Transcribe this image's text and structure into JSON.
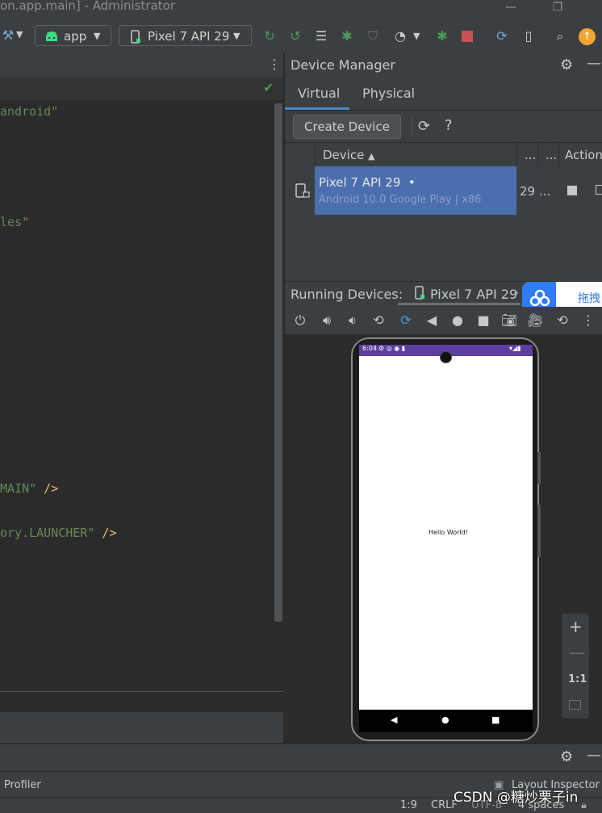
{
  "window": {
    "title": "on.app.main] - Administrator"
  },
  "toolbar": {
    "run_config": "app",
    "device_select": "Pixel 7 API 29"
  },
  "editor": {
    "lines": [
      {
        "text": "android\"",
        "kind": "str"
      },
      {
        "text": "les\"",
        "kind": "str"
      },
      {
        "text": "MAIN\"",
        "suffix": " />",
        "kind": "str"
      },
      {
        "text": "ory.LAUNCHER\"",
        "suffix": " />",
        "kind": "str"
      }
    ]
  },
  "device_manager": {
    "title": "Device Manager",
    "tabs": [
      "Virtual",
      "Physical"
    ],
    "active_tab": "Virtual",
    "create_button": "Create Device",
    "columns": {
      "device": "Device",
      "col2": "...",
      "col3": "...",
      "actions": "Action"
    },
    "devices": [
      {
        "name": "Pixel 7 API 29",
        "status_dot": "•",
        "details": "Android 10.0 Google Play | x86",
        "api": "29",
        "more": "..."
      }
    ]
  },
  "running_devices": {
    "label": "Running Devices:",
    "tab": "Pixel 7 API 29"
  },
  "baidu": {
    "label": "拖拽"
  },
  "emulator": {
    "time": "6:04",
    "content_text": "Hello World!",
    "zoom_ratio": "1:1"
  },
  "bottom": {
    "profiler": "Profiler",
    "layout_inspector": "Layout Inspector"
  },
  "statusline": {
    "position": "1:9",
    "line_sep": "CRLF",
    "encoding": "UTF-8",
    "indent": "4 spaces"
  },
  "watermark": "CSDN @糖炒栗子in",
  "colors": {
    "selection": "#4b6eaf",
    "accent_green": "#499c54",
    "stop_red": "#c75450",
    "update_orange": "#f0a732",
    "string_green": "#6a8759",
    "tag_yellow": "#e8bf6a"
  }
}
